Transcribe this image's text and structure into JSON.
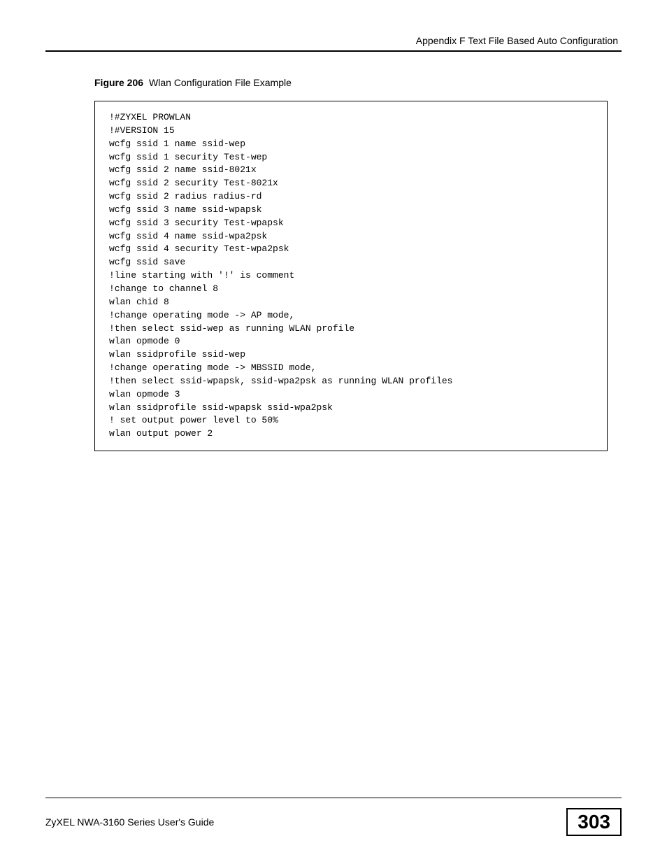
{
  "header": {
    "text": "Appendix F Text File Based Auto Configuration"
  },
  "figure": {
    "label": "Figure 206",
    "title": "Wlan Configuration File Example"
  },
  "code": "!#ZYXEL PROWLAN\n!#VERSION 15\nwcfg ssid 1 name ssid-wep\nwcfg ssid 1 security Test-wep\nwcfg ssid 2 name ssid-8021x\nwcfg ssid 2 security Test-8021x\nwcfg ssid 2 radius radius-rd\nwcfg ssid 3 name ssid-wpapsk\nwcfg ssid 3 security Test-wpapsk\nwcfg ssid 4 name ssid-wpa2psk\nwcfg ssid 4 security Test-wpa2psk\nwcfg ssid save\n!line starting with '!' is comment\n!change to channel 8\nwlan chid 8\n!change operating mode -> AP mode,\n!then select ssid-wep as running WLAN profile\nwlan opmode 0\nwlan ssidprofile ssid-wep\n!change operating mode -> MBSSID mode,\n!then select ssid-wpapsk, ssid-wpa2psk as running WLAN profiles\nwlan opmode 3\nwlan ssidprofile ssid-wpapsk ssid-wpa2psk\n! set output power level to 50%\nwlan output power 2",
  "footer": {
    "guide": "ZyXEL NWA-3160 Series User's Guide",
    "page": "303"
  }
}
